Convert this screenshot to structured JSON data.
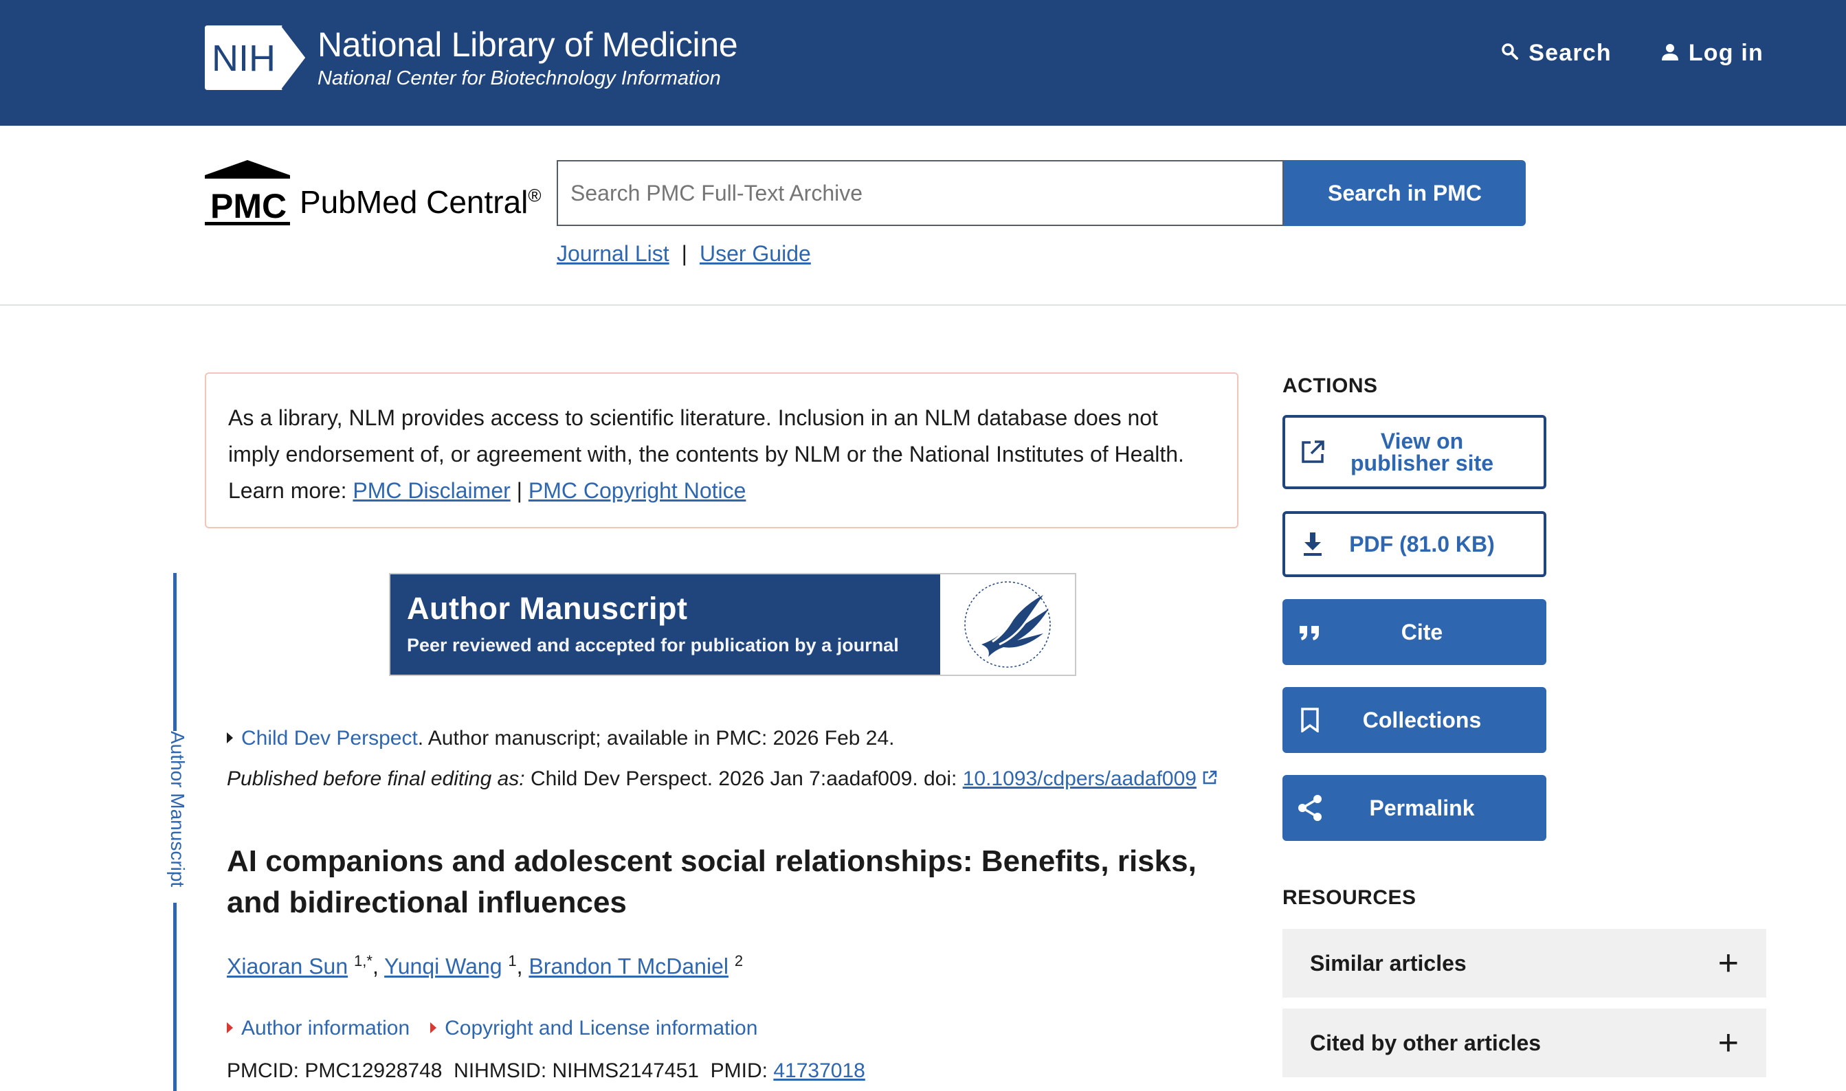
{
  "nih": {
    "logo_text": "NIH",
    "title": "National Library of Medicine",
    "subtitle": "National Center for Biotechnology Information",
    "search_label": "Search",
    "login_label": "Log in"
  },
  "pmc": {
    "logo_text": "PMC",
    "name": "PubMed Central",
    "reg": "®",
    "search_placeholder": "Search PMC Full-Text Archive",
    "search_button": "Search in PMC",
    "journal_list": "Journal List",
    "user_guide": "User Guide",
    "separator": "|"
  },
  "rail_label": "Author Manuscript",
  "disclaimer": {
    "text": "As a library, NLM provides access to scientific literature. Inclusion in an NLM database does not imply endorsement of, or agreement with, the contents by NLM or the National Institutes of Health.",
    "learn_more": "Learn more:",
    "link1": "PMC Disclaimer",
    "sep": "|",
    "link2": "PMC Copyright Notice"
  },
  "banner": {
    "title": "Author Manuscript",
    "subtitle": "Peer reviewed and accepted for publication by a journal"
  },
  "citation": {
    "journal": "Child Dev Perspect",
    "availability": ". Author manuscript; available in PMC: 2026 Feb 24.",
    "published_prefix": "Published before final editing as:",
    "published_rest": " Child Dev Perspect. 2026 Jan 7:aadaf009. doi: ",
    "doi": "10.1093/cdpers/aadaf009"
  },
  "article": {
    "title": "AI companions and adolescent social relationships: Benefits, risks, and bidirectional influences"
  },
  "authors": [
    {
      "name": "Xiaoran Sun",
      "sup": "1,*"
    },
    {
      "name": "Yunqi Wang",
      "sup": "1"
    },
    {
      "name": "Brandon T McDaniel",
      "sup": "2"
    }
  ],
  "info_links": {
    "author_info": "Author information",
    "copyright_info": "Copyright and License information"
  },
  "ids": {
    "pmcid_label": "PMCID:",
    "pmcid": "PMC12928748",
    "nihmsid_label": "NIHMSID:",
    "nihmsid": "NIHMS2147451",
    "pmid_label": "PMID:",
    "pmid": "41737018"
  },
  "actions": {
    "heading": "ACTIONS",
    "view_publisher_1": "View on",
    "view_publisher_2": "publisher site",
    "pdf": "PDF (81.0 KB)",
    "cite": "Cite",
    "collections": "Collections",
    "permalink": "Permalink"
  },
  "resources": {
    "heading": "RESOURCES",
    "similar": "Similar articles",
    "cited_by": "Cited by other articles"
  }
}
